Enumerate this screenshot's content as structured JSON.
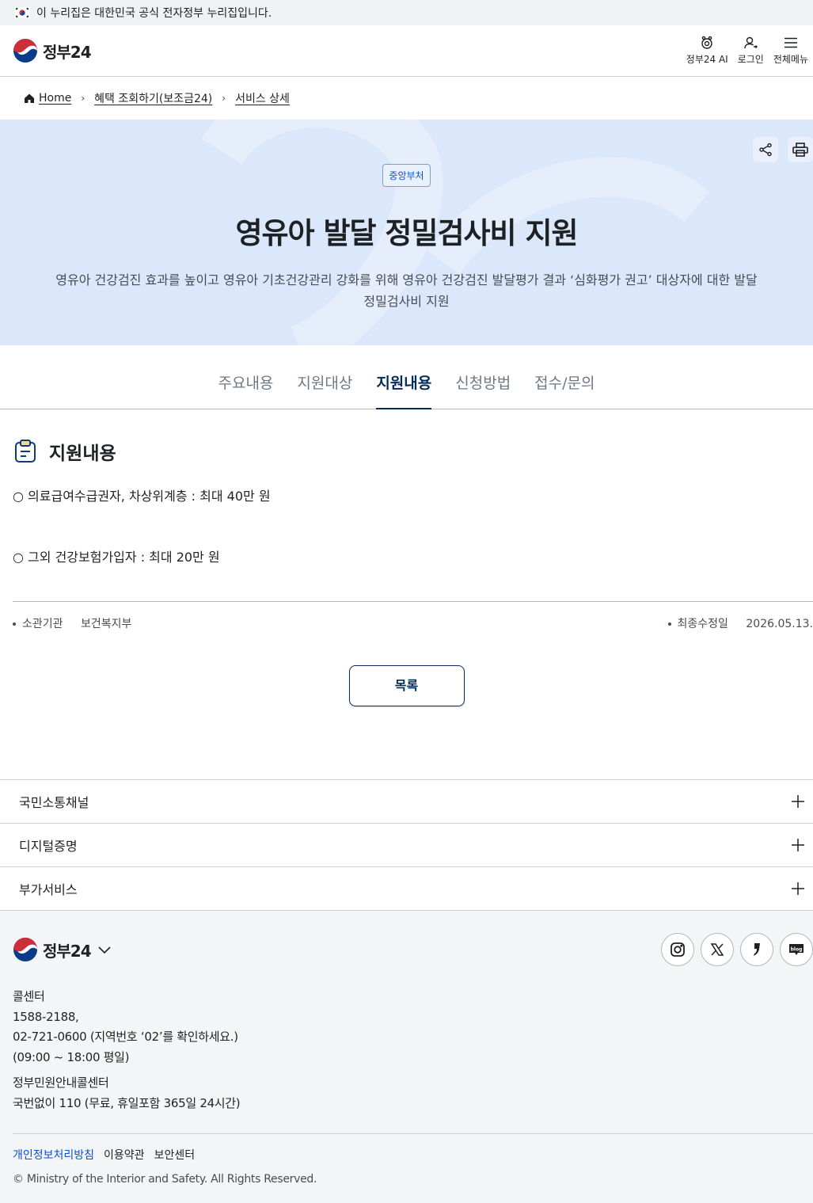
{
  "notice": {
    "text": "이 누리집은 대한민국 공식 전자정부 누리집입니다."
  },
  "header": {
    "logo_text": "정부24",
    "ai_label": "정부24 AI",
    "login_label": "로그인",
    "menu_label": "전체메뉴"
  },
  "breadcrumb": {
    "home": "Home",
    "level1": "혜택 조회하기(보조금24)",
    "level2": "서비스 상세"
  },
  "hero": {
    "badge": "중앙부처",
    "title": "영유아 발달 정밀검사비 지원",
    "desc_line1": "영유아 건강검진 효과를 높이고 영유아 기초건강관리 강화를 위해 영유아 건강검진 발달평가 결과 ‘심화평가 권고’ 대상자에 대한 발달",
    "desc_line2": "정밀검사비 지원"
  },
  "tabs": [
    {
      "label": "주요내용"
    },
    {
      "label": "지원대상"
    },
    {
      "label": "지원내용"
    },
    {
      "label": "신청방법"
    },
    {
      "label": "접수/문의"
    }
  ],
  "section": {
    "title": "지원내용",
    "lines": [
      "○ 의료급여수급권자, 차상위계층 : 최대 40만 원",
      "○ 그외 건강보험가입자 : 최대 20만 원"
    ]
  },
  "meta": {
    "agency_label": "소관기관",
    "agency_value": "보건복지부",
    "updated_label": "최종수정일",
    "updated_value": "2026.05.13."
  },
  "list_button": "목록",
  "accordions": [
    {
      "label": "국민소통채널"
    },
    {
      "label": "디지털증명"
    },
    {
      "label": "부가서비스"
    }
  ],
  "footer": {
    "logo_text": "정부24",
    "call_title": "콜센터",
    "call_line1": "1588-2188,",
    "call_line2": "02-721-0600 (지역번호 ‘02’를 확인하세요.)",
    "call_line3": "(09:00 ~ 18:00 평일)",
    "civil_title": "정부민원안내콜센터",
    "civil_line": "국번없이 110 (무료, 휴일포함 365일 24시간)",
    "links": [
      "개인정보처리방침",
      "이용약관",
      "보안센터"
    ],
    "copyright": "© Ministry of the Interior and Safety. All Rights Reserved."
  },
  "colors": {
    "primary": "#0b50d0",
    "navy": "#052b57",
    "hero_bg": "#dbe8fb",
    "footer_bg": "#f4f5f6"
  }
}
